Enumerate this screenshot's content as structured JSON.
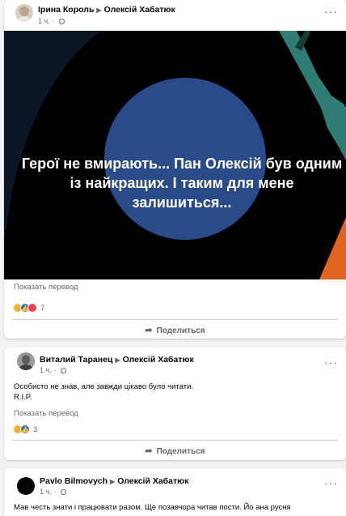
{
  "posts": [
    {
      "author": "Ірина Король",
      "target": "Олексій Хабатюк",
      "time": "1 ч.",
      "image_text": "Герої не вмирають... Пан Олексій був одним із найкращих. І таким для мене залишиться...",
      "translate_label": "Показать перевод",
      "reactions_count": "7",
      "share_label": "Поделиться"
    },
    {
      "author": "Виталий Таранец",
      "target": "Олексій Хабатюк",
      "time": "1 ч.",
      "text_line1": "Особисто не знав, але завжди цікаво було читати.",
      "text_line2": "R.I.P.",
      "translate_label": "Показать перевод",
      "reactions_count": "3",
      "share_label": "Поделиться"
    },
    {
      "author": "Pavlo Bilmovych",
      "target": "Олексій Хабатюк",
      "time": "1 ч.",
      "text_line1": "Мав честь знати і працювати разом. Ще позавчора читав пости. Йо ана русня"
    }
  ],
  "colors": {
    "circle": "#2a4b8a",
    "teal_shape": "#2e7c73",
    "orange_shape": "#e0661f",
    "dark_shape": "#0d1b2e"
  }
}
